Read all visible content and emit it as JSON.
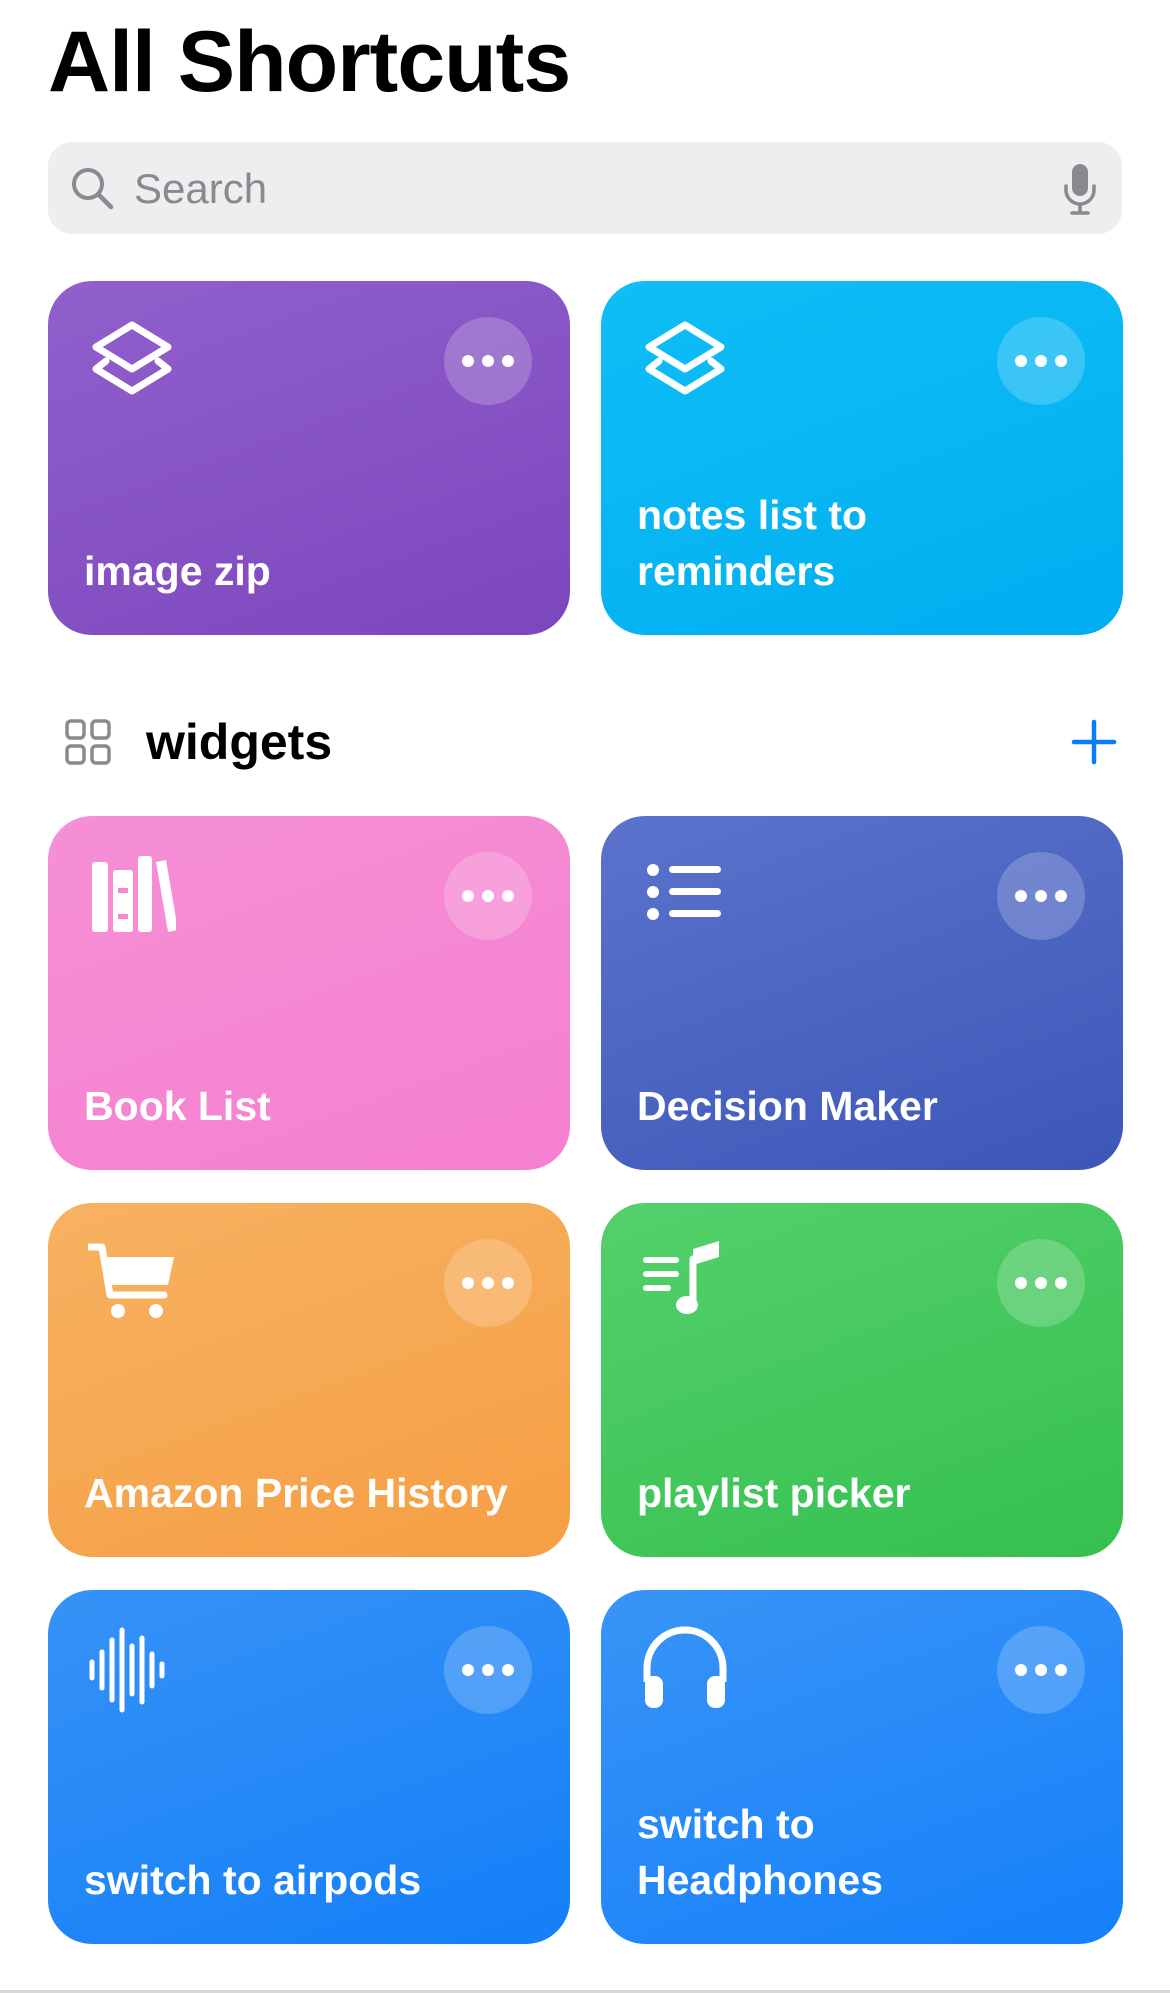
{
  "header": {
    "title": "All Shortcuts"
  },
  "search": {
    "placeholder": "Search",
    "icon": "search-icon",
    "mic_icon": "mic-icon"
  },
  "top_cards": [
    {
      "label": "image zip",
      "icon": "layers-icon",
      "color": "#8750c4"
    },
    {
      "label": "notes list to reminders",
      "icon": "layers-icon",
      "color": "#06b6f3"
    }
  ],
  "section": {
    "title": "widgets",
    "icon": "folder-grid-icon",
    "add_icon": "plus-icon",
    "accent": "#0a7aff"
  },
  "widget_cards": [
    {
      "label": "Book List",
      "icon": "books-icon",
      "color": "#f588d2"
    },
    {
      "label": "Decision Maker",
      "icon": "list-icon",
      "color": "#4a65c2"
    },
    {
      "label": "Amazon Price History",
      "icon": "cart-icon",
      "color": "#f6a84f"
    },
    {
      "label": "playlist picker",
      "icon": "music-list-icon",
      "color": "#44c85d"
    },
    {
      "label": "switch to airpods",
      "icon": "waveform-icon",
      "color": "#2187f7"
    },
    {
      "label": "switch to Headphones",
      "icon": "headphones-icon",
      "color": "#2589f8"
    }
  ]
}
